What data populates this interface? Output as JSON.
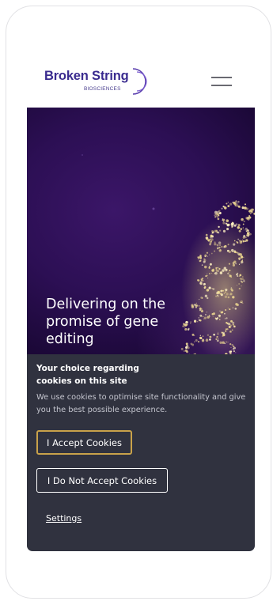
{
  "header": {
    "logo_main": "Broken String",
    "logo_sub": "BIOSCIENCES",
    "menu_icon": "hamburger-icon"
  },
  "hero": {
    "title": "Delivering on the promise of gene editing"
  },
  "cookie_banner": {
    "heading": "Your choice regarding cookies on this site",
    "description": "We use cookies to optimise site functionality and give you the best possible experience.",
    "accept_label": "I Accept Cookies",
    "decline_label": "I Do Not Accept Cookies",
    "settings_label": "Settings"
  },
  "colors": {
    "brand": "#3a2b8f",
    "hero_bg": "#2c0f54",
    "banner_bg": "#30323f",
    "accent_border": "#c9a24a"
  }
}
